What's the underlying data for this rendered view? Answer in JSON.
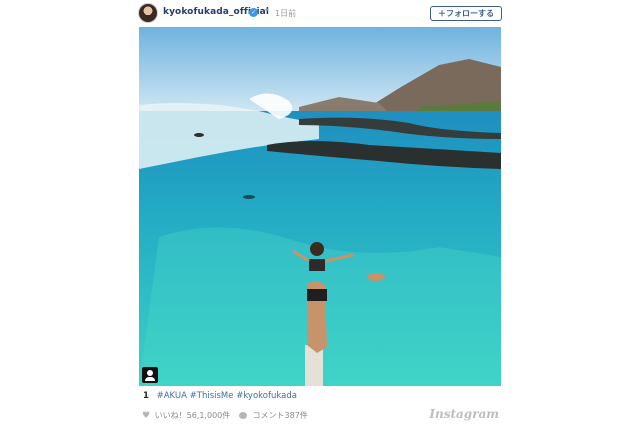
{
  "header": {
    "username": "kyokofukada_official",
    "verified_symbol": "✓",
    "separator": "•",
    "time": "1日前",
    "follow_label": "＋フォローする"
  },
  "photo": {
    "description_icon": "user-tag-icon"
  },
  "caption": {
    "count": "1",
    "hashtags": "#AKUA #ThisisMe #kyokofukada"
  },
  "footer": {
    "likes_label": "いいね！56,1,000件",
    "comments_label": "コメント387件",
    "brand": "Instagram"
  },
  "colors": {
    "link": "#3d6fa3",
    "username": "#1f3e6b",
    "verified": "#3897f0",
    "water": "#2ab8c6"
  }
}
